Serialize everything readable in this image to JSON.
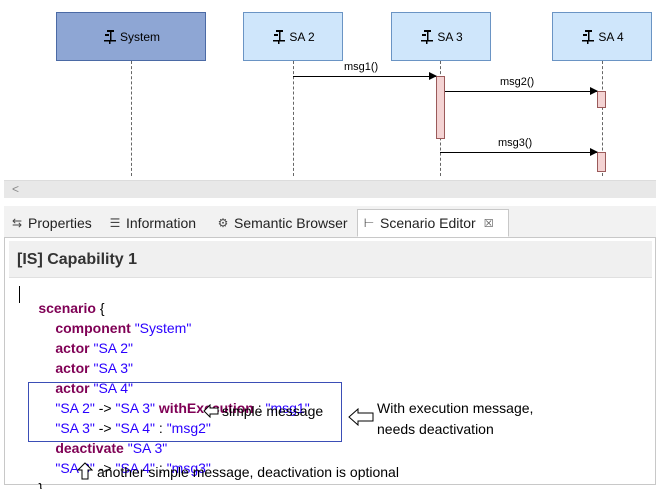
{
  "diagram": {
    "lifelines": [
      {
        "name": "System",
        "kind": "component"
      },
      {
        "name": "SA 2",
        "kind": "actor"
      },
      {
        "name": "SA 3",
        "kind": "actor"
      },
      {
        "name": "SA 4",
        "kind": "actor"
      }
    ],
    "messages": [
      {
        "label": "msg1()"
      },
      {
        "label": "msg2()"
      },
      {
        "label": "msg3()"
      }
    ]
  },
  "scrollbar": {
    "left_arrow": "<"
  },
  "tabs": [
    {
      "label": "Properties",
      "icon": "properties-icon",
      "active": false
    },
    {
      "label": "Information",
      "icon": "information-icon",
      "active": false
    },
    {
      "label": "Semantic Browser",
      "icon": "semantic-browser-icon",
      "active": false
    },
    {
      "label": "Scenario Editor",
      "icon": "scenario-editor-icon",
      "active": true,
      "close": "☒"
    }
  ],
  "editor": {
    "title": "[IS] Capability 1",
    "lines": {
      "l1_kw": "scenario",
      "l1_rest": " {",
      "l2_kw": "component",
      "l2_str": "\"System\"",
      "l3_kw": "actor",
      "l3_str": "\"SA 2\"",
      "l4_kw": "actor",
      "l4_str": "\"SA 3\"",
      "l5_kw": "actor",
      "l5_str": "\"SA 4\"",
      "l6_a": "\"SA 2\"",
      "l6_arrow": " -> ",
      "l6_b": "\"SA 3\"",
      "l6_kw": "withExecution",
      "l6_colon": " : ",
      "l6_c": "\"msg1\"",
      "l7_a": "\"SA 3\"",
      "l7_arrow": " -> ",
      "l7_b": "\"SA 4\"",
      "l7_colon": " : ",
      "l7_c": "\"msg2\"",
      "l8_kw": "deactivate",
      "l8_str": "\"SA 3\"",
      "l9_a": "\"SA 3\"",
      "l9_arrow": " -> ",
      "l9_b": "\"SA 4\"",
      "l9_colon": " : ",
      "l9_c": "\"msg3\"",
      "l10": "}"
    },
    "annotations": {
      "simple_message": "simple message",
      "with_execution_1": "With execution message,",
      "with_execution_2": "needs deactivation",
      "another_simple": "another simple message, deactivation is optional"
    }
  }
}
